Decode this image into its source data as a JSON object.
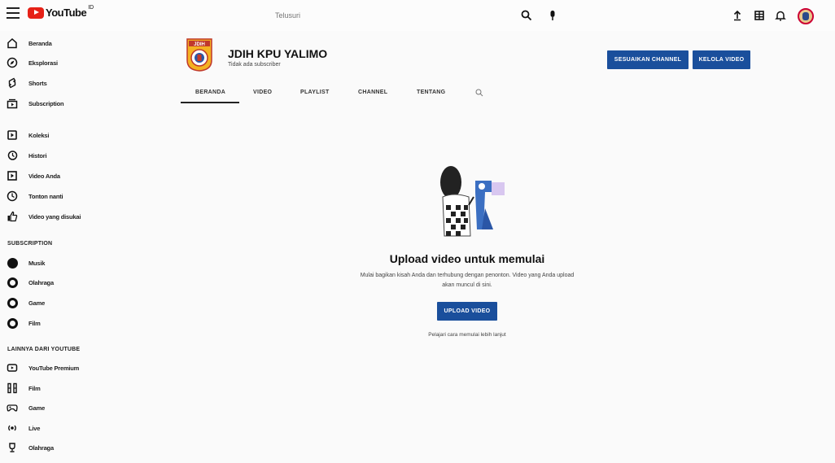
{
  "app": {
    "logo_text": "YouTube",
    "region": "ID"
  },
  "search": {
    "placeholder": "Telusuri"
  },
  "sidebar": {
    "main": [
      {
        "label": "Beranda",
        "icon": "home-icon"
      },
      {
        "label": "Eksplorasi",
        "icon": "compass-icon"
      },
      {
        "label": "Shorts",
        "icon": "shorts-icon"
      },
      {
        "label": "Subscription",
        "icon": "subscriptions-icon"
      }
    ],
    "library": [
      {
        "label": "Koleksi",
        "icon": "library-icon"
      },
      {
        "label": "Histori",
        "icon": "history-icon"
      },
      {
        "label": "Video Anda",
        "icon": "your-videos-icon"
      },
      {
        "label": "Tonton nanti",
        "icon": "clock-icon"
      },
      {
        "label": "Video yang disukai",
        "icon": "thumbs-up-icon"
      }
    ],
    "subscription_heading": "SUBSCRIPTION",
    "subscriptions": [
      {
        "label": "Musik"
      },
      {
        "label": "Olahraga"
      },
      {
        "label": "Game"
      },
      {
        "label": "Film"
      }
    ],
    "more_heading": "LAINNYA DARI YOUTUBE",
    "more": [
      {
        "label": "YouTube Premium",
        "icon": "premium-icon"
      },
      {
        "label": "Film",
        "icon": "film-icon"
      },
      {
        "label": "Game",
        "icon": "gamepad-icon"
      },
      {
        "label": "Live",
        "icon": "live-icon"
      },
      {
        "label": "Olahraga",
        "icon": "trophy-icon"
      }
    ]
  },
  "channel": {
    "name": "JDIH KPU YALIMO",
    "subscribers": "Tidak ada subscriber",
    "customize_label": "SESUAIKAN CHANNEL",
    "manage_label": "KELOLA VIDEO",
    "logo_text": "JDIH"
  },
  "tabs": [
    {
      "label": "BERANDA"
    },
    {
      "label": "VIDEO"
    },
    {
      "label": "PLAYLIST"
    },
    {
      "label": "CHANNEL"
    },
    {
      "label": "TENTANG"
    }
  ],
  "empty_state": {
    "title": "Upload video untuk memulai",
    "description": "Mulai bagikan kisah Anda dan terhubung dengan penonton. Video yang Anda upload akan muncul di sini.",
    "button_label": "UPLOAD VIDEO",
    "learn_more": "Pelajari cara memulai lebih lanjut"
  },
  "colors": {
    "accent": "#1a4f9c",
    "brand": "#e62117"
  }
}
